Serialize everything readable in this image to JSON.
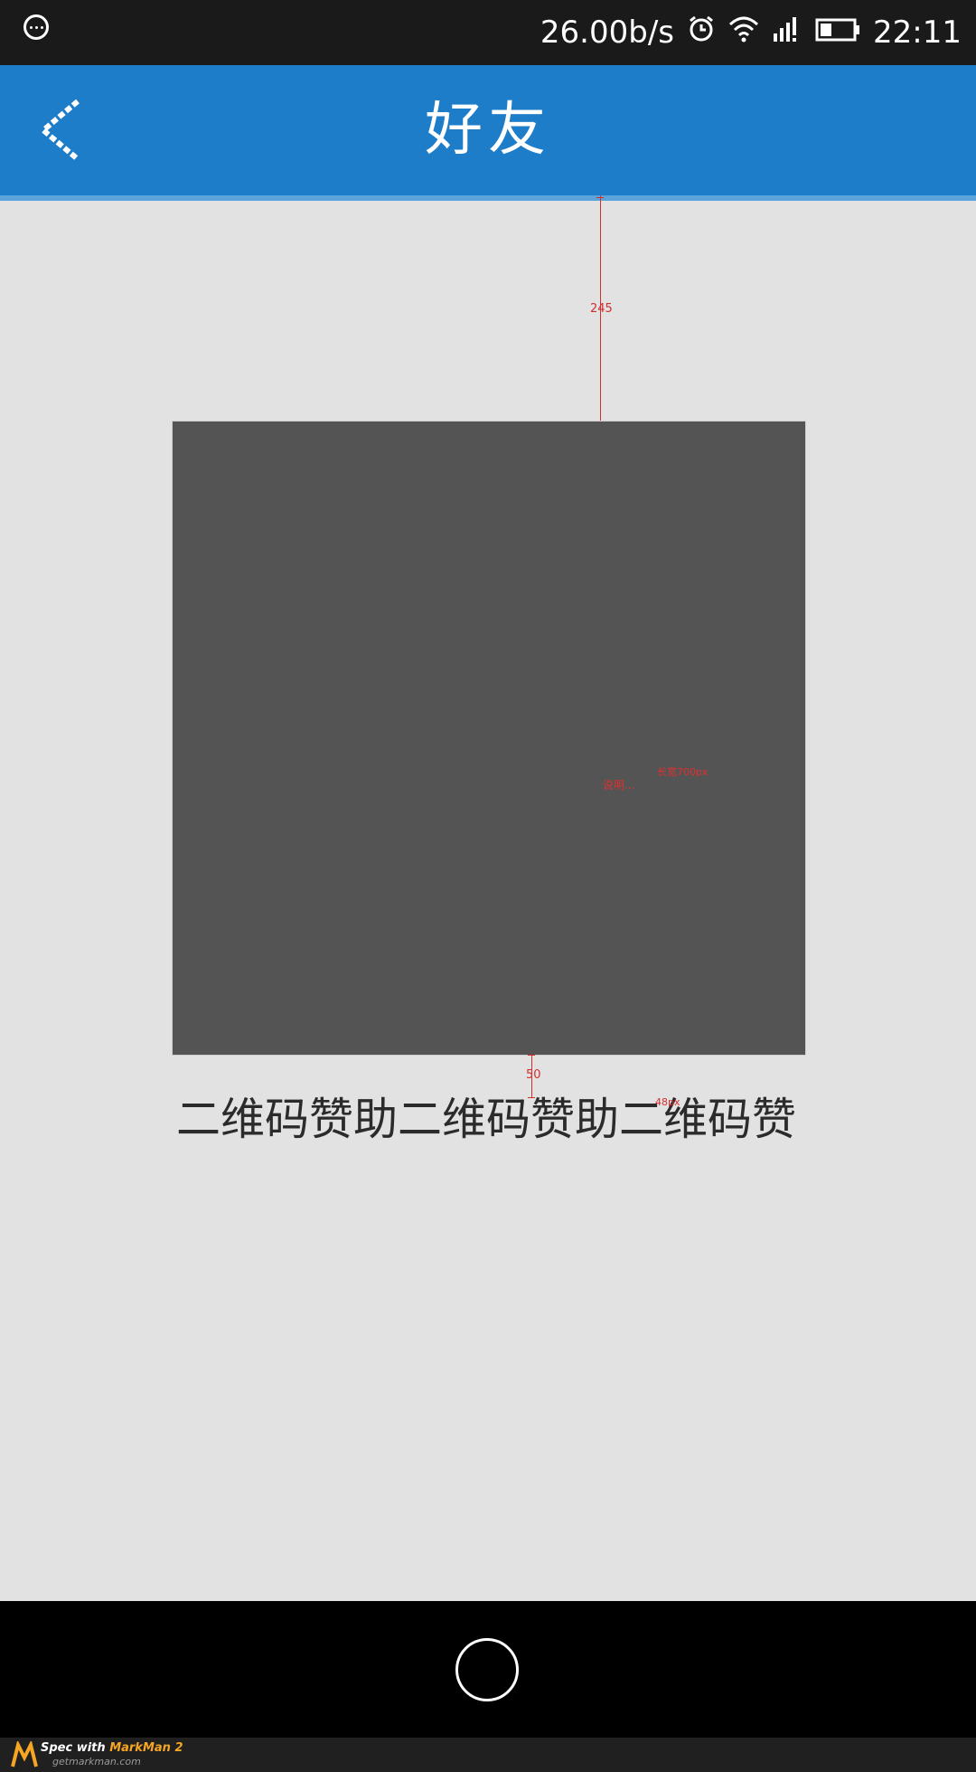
{
  "status_bar": {
    "network_speed": "26.00b/s",
    "time": "22:11",
    "icons": [
      "menu-dots-icon",
      "alarm-icon",
      "wifi-icon",
      "signal-icon",
      "battery-icon"
    ]
  },
  "app_bar": {
    "title": "好友",
    "back_icon": "chevron-left-icon"
  },
  "main": {
    "qr_note": "说明...",
    "qr_size_note": "长宽700px",
    "caption": "二维码赞助二维码赞助二维码赞"
  },
  "annotations": {
    "top_gap": "245",
    "caption_gap": "50",
    "caption_font": "48px"
  },
  "colors": {
    "app_bar": "#1e7dc9",
    "background": "#e2e2e2",
    "qr_placeholder": "#545454",
    "annotation": "#d32f2f"
  },
  "watermark": {
    "prefix": "Spec with ",
    "brand": "MarkMan 2",
    "url": "getmarkman.com"
  }
}
